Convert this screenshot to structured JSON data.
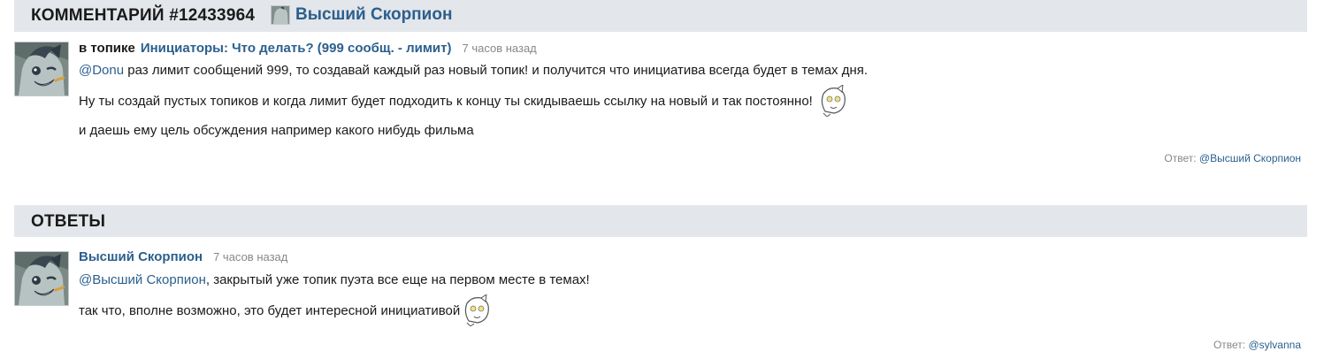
{
  "comment_header": {
    "title": "КОММЕНТАРИЙ #12433964",
    "author": "Высший Скорпион"
  },
  "comment": {
    "in_topic_label": "в топике",
    "topic_title": "Инициаторы: Что делать? (999 сообщ. - лимит)",
    "time": "7 часов назад",
    "line1_mention": "@Donu",
    "line1_text": " раз лимит сообщений 999, то создавай каждый раз новый топик! и получится что инициатива всегда будет в темах дня.",
    "line2_text": "Ну ты создай пустых топиков и когда лимит будет подходить к концу ты скидываешь ссылку на новый и так постоянно!",
    "line3_text": "и даешь ему цель обсуждения например какого нибудь фильма",
    "reply_label": "Ответ: ",
    "reply_target": "@Высший Скорпион"
  },
  "answers_header": {
    "title": "ОТВЕТЫ"
  },
  "answer": {
    "author": "Высший Скорпион",
    "time": "7 часов назад",
    "line1_mention": "@Высший Скорпион",
    "line1_text": ", закрытый уже топик пуэта все еще на первом месте в темах!",
    "line2_text": "так что, вполне возможно, это будет интересной инициативой",
    "reply_label": "Ответ: ",
    "reply_target": "@sylvanna"
  },
  "colors": {
    "header_bg": "#e3e6ea",
    "link": "#2b5f8e",
    "muted": "#888888"
  },
  "icons": {
    "avatar": "pony-avatar-icon",
    "smiley": "pony-smiley-icon"
  }
}
